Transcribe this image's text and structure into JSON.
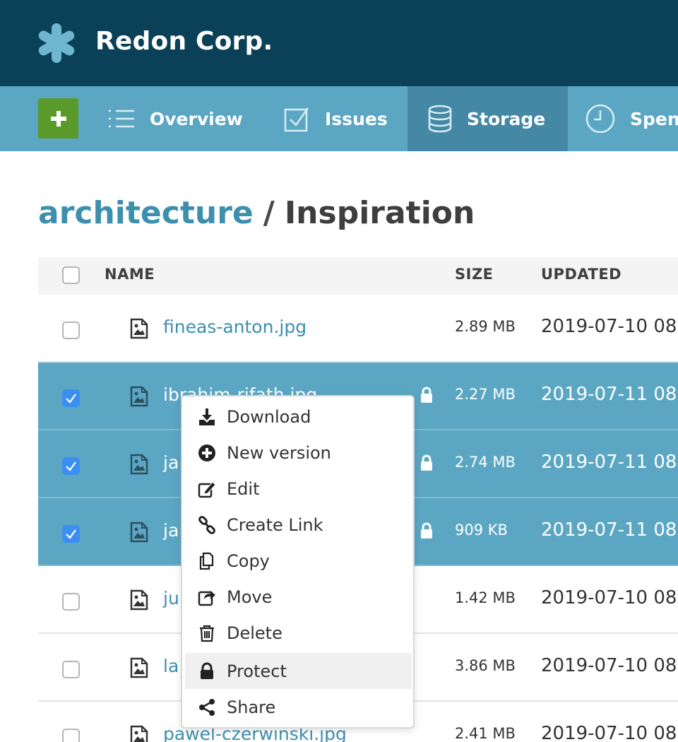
{
  "app": {
    "brand": "Redon Corp.",
    "logo_icon": "asterisk-logo-icon",
    "colors": {
      "header": "#0b4059",
      "nav": "#5ba6c3",
      "nav_active": "#4488a5",
      "add_button": "#5a9a2a",
      "link": "#3d8fae",
      "selected_row": "#5ba6c3",
      "checkbox_checked": "#3c8ff2"
    }
  },
  "nav": {
    "add_icon": "plus-icon",
    "items": [
      {
        "label": "Overview",
        "icon": "list-icon",
        "active": false
      },
      {
        "label": "Issues",
        "icon": "checkbox-icon",
        "active": false
      },
      {
        "label": "Storage",
        "icon": "database-icon",
        "active": true
      },
      {
        "label": "Spen",
        "icon": "clock-icon",
        "active": false
      }
    ]
  },
  "breadcrumb": {
    "parent": "architecture",
    "separator": "/",
    "current": "Inspiration"
  },
  "table": {
    "headers": {
      "name": "NAME",
      "size": "SIZE",
      "updated": "UPDATED"
    },
    "rows": [
      {
        "name": "fineas-anton.jpg",
        "size": "2.89 MB",
        "updated": "2019-07-10 08",
        "selected": false,
        "locked": false
      },
      {
        "name": "ibrahim-rifath.jpg",
        "size": "2.27 MB",
        "updated": "2019-07-11 08",
        "selected": true,
        "locked": true
      },
      {
        "name": "ja",
        "size": "2.74 MB",
        "updated": "2019-07-11 08",
        "selected": true,
        "locked": true
      },
      {
        "name": "ja",
        "size": "909 KB",
        "updated": "2019-07-11 08",
        "selected": true,
        "locked": true
      },
      {
        "name": "ju",
        "size": "1.42 MB",
        "updated": "2019-07-10 08",
        "selected": false,
        "locked": false
      },
      {
        "name": "la",
        "size": "3.86 MB",
        "updated": "2019-07-10 08",
        "selected": false,
        "locked": false
      },
      {
        "name": "pawel-czerwinski.jpg",
        "size": "2.41 MB",
        "updated": "2019-07-10 08",
        "selected": false,
        "locked": false
      }
    ]
  },
  "context_menu": {
    "items": [
      {
        "label": "Download",
        "icon": "download-icon"
      },
      {
        "label": "New version",
        "icon": "plus-circle-icon"
      },
      {
        "label": "Edit",
        "icon": "edit-icon"
      },
      {
        "label": "Create Link",
        "icon": "link-icon"
      },
      {
        "label": "Copy",
        "icon": "copy-icon"
      },
      {
        "label": "Move",
        "icon": "move-icon"
      },
      {
        "label": "Delete",
        "icon": "trash-icon"
      },
      {
        "label": "Protect",
        "icon": "lock-icon",
        "highlighted": true
      },
      {
        "label": "Share",
        "icon": "share-icon"
      }
    ]
  }
}
